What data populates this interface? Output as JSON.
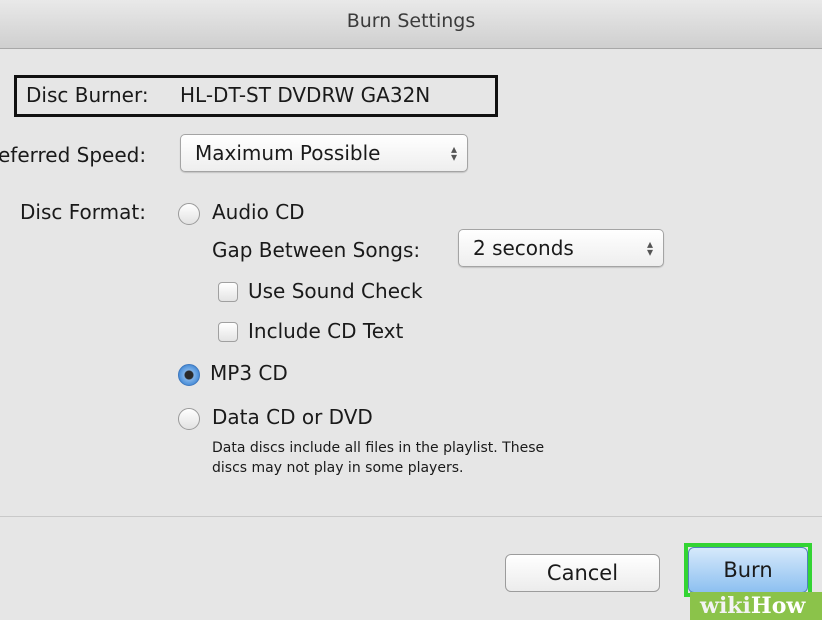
{
  "window": {
    "title": "Burn Settings"
  },
  "disc_burner": {
    "label": "Disc Burner:",
    "value": "HL-DT-ST DVDRW  GA32N"
  },
  "preferred_speed": {
    "label": "eferred Speed:",
    "value": "Maximum Possible"
  },
  "disc_format": {
    "label": "Disc Format:",
    "options": [
      {
        "label": "Audio CD",
        "selected": false
      },
      {
        "label": "MP3 CD",
        "selected": true
      },
      {
        "label": "Data CD or DVD",
        "selected": false
      }
    ],
    "gap": {
      "label": "Gap Between Songs:",
      "value": "2 seconds"
    },
    "use_sound_check": {
      "label": "Use Sound Check",
      "checked": false
    },
    "include_cd_text": {
      "label": "Include CD Text",
      "checked": false
    },
    "data_note_line1": "Data discs include all files in the playlist.  These",
    "data_note_line2": "discs may not play in some players."
  },
  "buttons": {
    "cancel": "Cancel",
    "burn": "Burn"
  },
  "watermark": {
    "wiki": "wiki",
    "how": "How"
  },
  "colors": {
    "highlight_box": "#111111",
    "burn_highlight": "#33d433",
    "selected_radio": "#4a8ed8"
  }
}
